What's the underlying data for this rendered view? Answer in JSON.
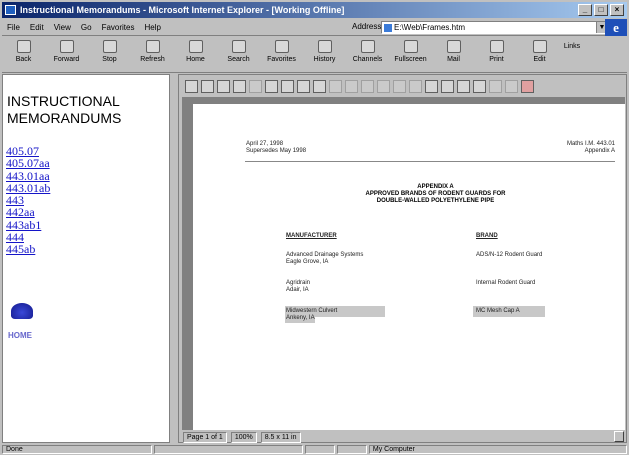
{
  "window": {
    "title": "Instructional Memorandums - Microsoft Internet Explorer - [Working Offline]"
  },
  "menu": [
    "File",
    "Edit",
    "View",
    "Go",
    "Favorites",
    "Help"
  ],
  "address": {
    "label": "Address",
    "value": "E:\\Web\\Frames.htm"
  },
  "toolbar": [
    "Back",
    "Forward",
    "Stop",
    "Refresh",
    "Home",
    "Search",
    "Favorites",
    "History",
    "Channels",
    "Fullscreen",
    "Mail",
    "Print",
    "Edit",
    "Links"
  ],
  "nav": {
    "title": "INSTRUCTIONAL MEMORANDUMS",
    "links": [
      "405.07",
      "405.07aa",
      "443.01aa",
      "443.01ab",
      "443",
      "442aa",
      "443ab1",
      "444",
      "445ab"
    ],
    "home_label": "HOME"
  },
  "document": {
    "date_line1": "April 27, 1998",
    "date_line2": "Supersedes May 1998",
    "ref_line1": "Maths I.M. 443.01",
    "ref_line2": "Appendix A",
    "appendix_title": "APPENDIX A",
    "appendix_sub1": "APPROVED BRANDS OF RODENT GUARDS FOR",
    "appendix_sub2": "DOUBLE-WALLED POLYETHYLENE PIPE",
    "col_manufacturer": "MANUFACTURER",
    "col_brand": "BRAND",
    "rows": [
      {
        "m1": "Advanced Drainage Systems",
        "m2": "Eagle Grove, IA",
        "brand": "ADS/N-12 Rodent Guard"
      },
      {
        "m1": "Agridrain",
        "m2": "Adair, IA",
        "brand": "Internal Rodent Guard"
      },
      {
        "m1": "Midwestern Culvert",
        "m2": "Ankeny, IA",
        "brand": "MC Mesh Cap A"
      }
    ]
  },
  "pdf_status": {
    "page": "Page 1 of 1",
    "zoom": "100%",
    "size": "8.5 x 11 in"
  },
  "status": {
    "text": "Done",
    "zone": "My Computer"
  }
}
